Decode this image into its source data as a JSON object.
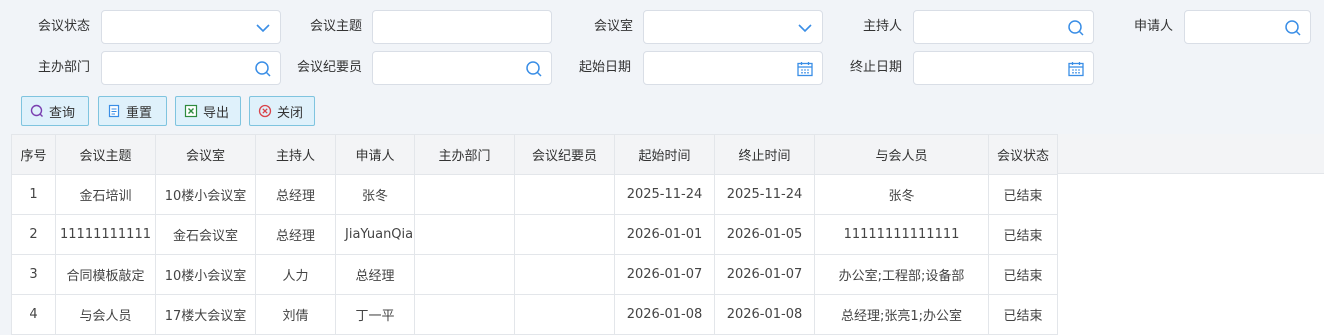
{
  "filters": {
    "status_label": "会议状态",
    "topic_label": "会议主题",
    "room_label": "会议室",
    "host_label": "主持人",
    "applicant_label": "申请人",
    "dept_label": "主办部门",
    "recorder_label": "会议纪要员",
    "start_label": "起始日期",
    "end_label": "终止日期"
  },
  "buttons": {
    "query": "查询",
    "reset": "重置",
    "export": "导出",
    "close": "关闭"
  },
  "table": {
    "headers": [
      "序号",
      "会议主题",
      "会议室",
      "主持人",
      "申请人",
      "主办部门",
      "会议纪要员",
      "起始时间",
      "终止时间",
      "与会人员",
      "会议状态"
    ],
    "rows": [
      [
        "1",
        "金石培训",
        "10楼小会议室",
        "总经理",
        "张冬",
        "",
        "",
        "2025-11-24",
        "2025-11-24",
        "张冬",
        "已结束"
      ],
      [
        "2",
        "11111111111",
        "金石会议室",
        "总经理",
        "JiaYuanQia",
        "",
        "",
        "2026-01-01",
        "2026-01-05",
        "11111111111111",
        "已结束"
      ],
      [
        "3",
        "合同模板敲定",
        "10楼小会议室",
        "人力",
        "总经理",
        "",
        "",
        "2026-01-07",
        "2026-01-07",
        "办公室;工程部;设备部",
        "已结束"
      ],
      [
        "4",
        "与会人员",
        "17楼大会议室",
        "刘倩",
        "丁一平",
        "",
        "",
        "2026-01-08",
        "2026-01-08",
        "总经理;张亮1;办公室",
        "已结束"
      ]
    ]
  },
  "colors": {
    "icon_blue": "#3a8ee6",
    "button_bg": "#dff1fb",
    "button_border": "#7fc4df"
  }
}
